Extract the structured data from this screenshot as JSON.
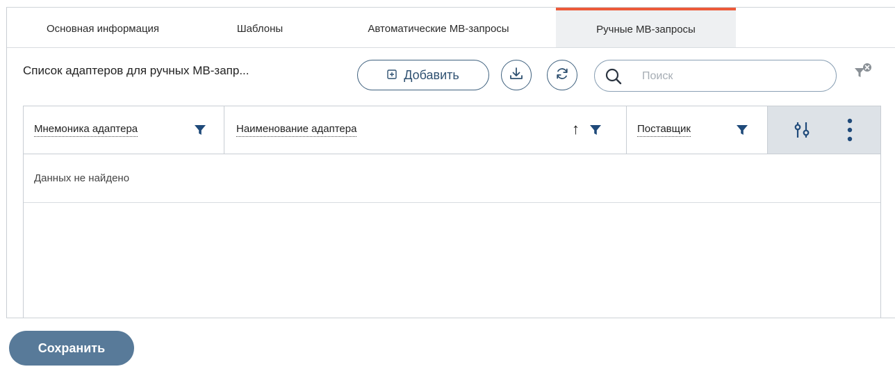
{
  "tabs": [
    {
      "label": "Основная информация",
      "active": false
    },
    {
      "label": "Шаблоны",
      "active": false
    },
    {
      "label": "Автоматические МВ-запросы",
      "active": false
    },
    {
      "label": "Ручные МВ-запросы",
      "active": true
    }
  ],
  "toolbar": {
    "list_title": "Список адаптеров для ручных МВ-запр...",
    "add_label": "Добавить",
    "search_placeholder": "Поиск",
    "search_value": ""
  },
  "table": {
    "columns": [
      {
        "label": "Мнемоника адаптера",
        "sort": ""
      },
      {
        "label": "Наименование адаптера",
        "sort": "↑"
      },
      {
        "label": "Поставщик",
        "sort": ""
      }
    ],
    "empty_text": "Данных не найдено"
  },
  "footer": {
    "save_label": "Сохранить"
  },
  "colors": {
    "accent": "#ec5a3a",
    "primary": "#3d5f7d",
    "save_button": "#587a99",
    "filter_icon": "#1f4a7a",
    "tools_column_bg": "#dde2e7"
  },
  "icons": {
    "add": "plus-square-icon",
    "export": "download-icon",
    "refresh": "refresh-icon",
    "search": "search-icon",
    "clear_filters": "filter-clear-icon",
    "column_filter": "filter-icon",
    "column_settings": "sliders-icon",
    "more": "more-vertical-icon"
  }
}
